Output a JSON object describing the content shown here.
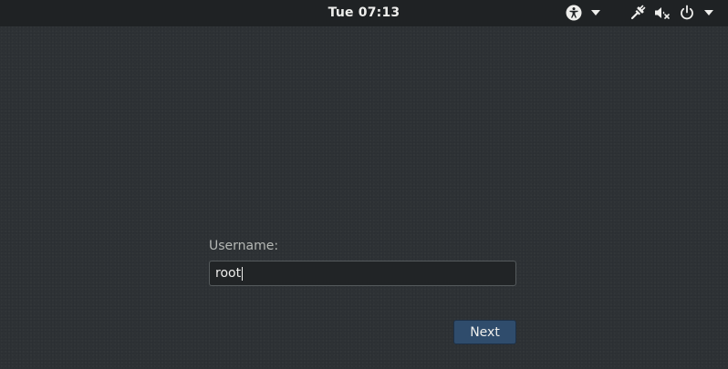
{
  "topbar": {
    "clock": "Tue 07:13",
    "icons": {
      "accessibility": "accessibility-icon",
      "network": "wired-network-icon",
      "volume": "volume-muted-icon",
      "power": "power-icon",
      "menu_arrow": "chevron-down-icon"
    }
  },
  "login": {
    "username_label": "Username:",
    "username_value": "root",
    "next_label": "Next"
  },
  "colors": {
    "background": "#2e3235",
    "topbar": "#1f2224",
    "accent": "#2f4c6c",
    "text": "#eeeeec"
  }
}
